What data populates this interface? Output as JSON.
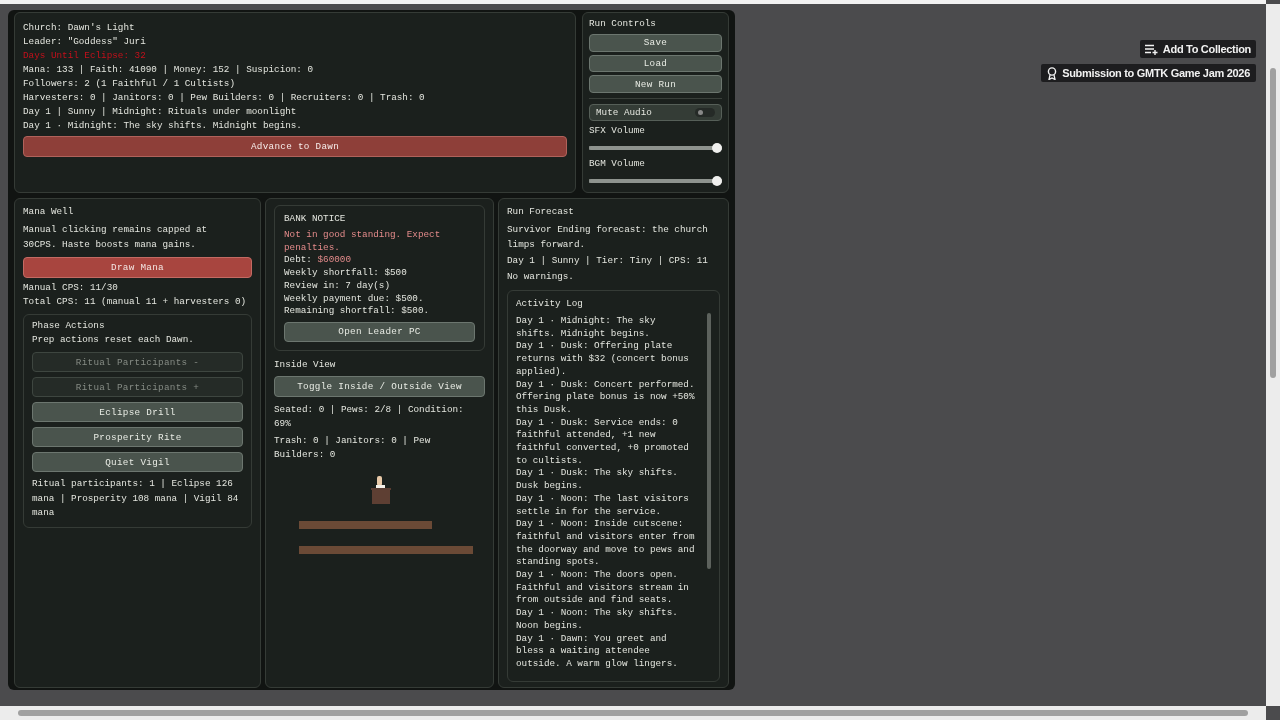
{
  "status": {
    "church": "Church: Dawn's Light",
    "leader": "Leader: \"Goddess\" Juri",
    "eclipse_countdown": "Days Until Eclipse: 32",
    "resources": "Mana: 133 | Faith: 41090 | Money: 152 | Suspicion: 0",
    "followers": "Followers: 2 (1 Faithful / 1 Cultists)",
    "workers": "Harvesters: 0 | Janitors: 0 | Pew Builders: 0 | Recruiters: 0 | Trash: 0",
    "phase": "Day 1 | Sunny | Midnight: Rituals under moonlight",
    "last_event": "Day 1 · Midnight: The sky shifts. Midnight begins.",
    "advance_button": "Advance to Dawn"
  },
  "run_controls": {
    "title": "Run Controls",
    "buttons": [
      "Save",
      "Load",
      "New Run"
    ],
    "mute": {
      "label": "Mute Audio",
      "on": false
    },
    "sliders": [
      {
        "label": "SFX Volume",
        "level": 1
      },
      {
        "label": "BGM Volume",
        "level": 1
      }
    ]
  },
  "mana_well": {
    "title": "Mana Well",
    "description": "Manual clicking remains capped at 30CPS. Haste boosts mana gains.",
    "draw_button": "Draw Mana",
    "manual_cps": "Manual CPS: 11/30",
    "total_cps": "Total CPS: 11 (manual 11 + harvesters 0)",
    "phase_actions": {
      "title": "Phase Actions",
      "note": "Prep actions reset each Dawn.",
      "actions": [
        {
          "label": "Ritual Participants -",
          "disabled": true
        },
        {
          "label": "Ritual Participants +",
          "disabled": true
        },
        {
          "label": "Eclipse Drill",
          "disabled": false
        },
        {
          "label": "Prosperity Rite",
          "disabled": false
        },
        {
          "label": "Quiet Vigil",
          "disabled": false
        }
      ],
      "summary": "Ritual participants: 1 | Eclipse 126 mana | Prosperity 108 mana | Vigil 84 mana"
    }
  },
  "bank_notice": {
    "title": "BANK NOTICE",
    "warning": "Not in good standing. Expect penalties.",
    "debt_label": "Debt:",
    "debt_value": "$60000",
    "lines": [
      "Weekly shortfall: $500",
      "Review in: 7 day(s)",
      "Weekly payment due: $500.",
      "Remaining shortfall: $500."
    ],
    "button": "Open Leader PC"
  },
  "inside_view": {
    "title": "Inside View",
    "toggle_button": "Toggle Inside / Outside View",
    "seating": "Seated: 0 | Pews: 2/8 | Condition: 69%",
    "staff": "Trash: 0 | Janitors: 0 | Pew Builders: 0"
  },
  "forecast": {
    "title": "Run Forecast",
    "text": "Survivor Ending forecast: the church limps forward.",
    "summary": "Day 1 | Sunny | Tier: Tiny | CPS: 11",
    "warnings": "No warnings."
  },
  "activity_log": {
    "title": "Activity Log",
    "entries": [
      "Day 1 · Midnight: The sky shifts. Midnight begins.",
      "Day 1 · Dusk: Offering plate returns with $32 (concert bonus applied).",
      "Day 1 · Dusk: Concert performed. Offering plate bonus is now +50% this Dusk.",
      "Day 1 · Dusk: Service ends: 0 faithful attended, +1 new faithful converted, +0 promoted to cultists.",
      "Day 1 · Dusk: The sky shifts. Dusk begins.",
      "Day 1 · Noon: The last visitors settle in for the service.",
      "Day 1 · Noon: Inside cutscene: faithful and visitors enter from the doorway and move to pews and standing spots.",
      "Day 1 · Noon: The doors open. Faithful and visitors stream in from outside and find seats.",
      "Day 1 · Noon: The sky shifts. Noon begins.",
      "Day 1 · Dawn: You greet and bless a waiting attendee outside. A warm glow lingers."
    ]
  },
  "page_links": {
    "collection_button": "Add To Collection",
    "jam_badge": "Submission to GMTK Game Jam 2026"
  }
}
